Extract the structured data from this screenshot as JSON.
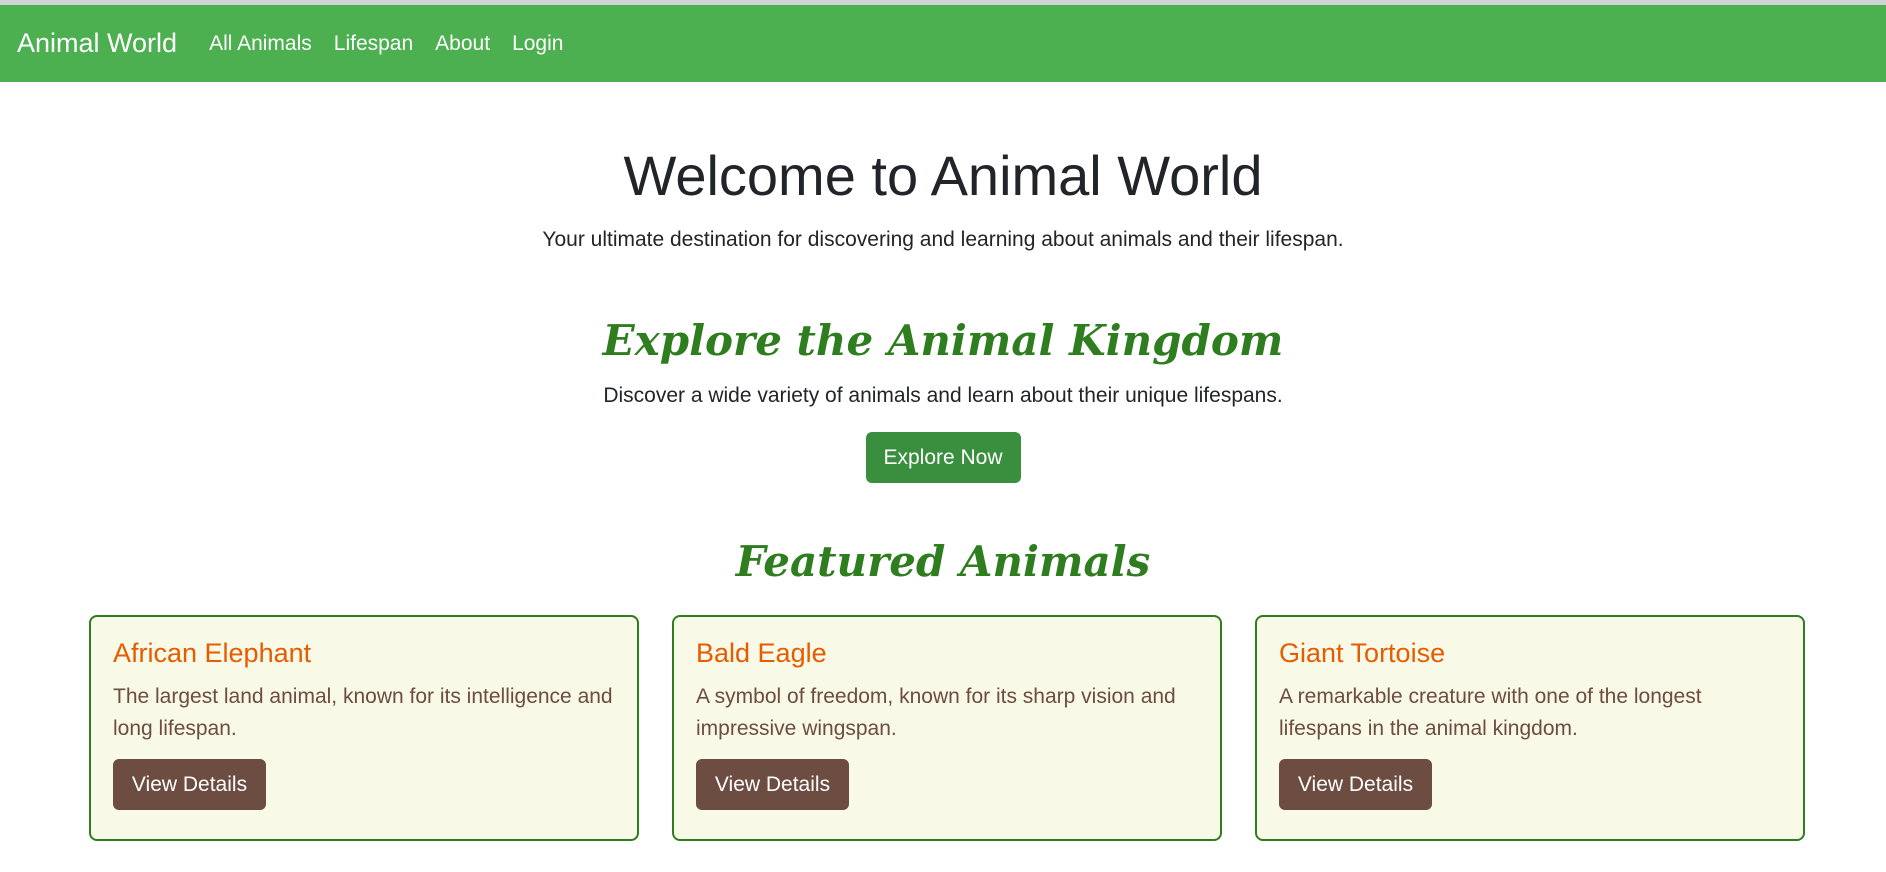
{
  "navbar": {
    "brand": "Animal World",
    "links": [
      "All Animals",
      "Lifespan",
      "About",
      "Login"
    ]
  },
  "hero": {
    "title": "Welcome to Animal World",
    "subtitle": "Your ultimate destination for discovering and learning about animals and their lifespan."
  },
  "explore": {
    "heading": "Explore the Animal Kingdom",
    "text": "Discover a wide variety of animals and learn about their unique lifespans.",
    "button_label": "Explore Now"
  },
  "featured": {
    "heading": "Featured Animals",
    "cards": [
      {
        "title": "African Elephant",
        "text": "The largest land animal, known for its intelligence and long lifespan.",
        "button_label": "View Details"
      },
      {
        "title": "Bald Eagle",
        "text": "A symbol of freedom, known for its sharp vision and impressive wingspan.",
        "button_label": "View Details"
      },
      {
        "title": "Giant Tortoise",
        "text": "A remarkable creature with one of the longest lifespans in the animal kingdom.",
        "button_label": "View Details"
      }
    ]
  },
  "colors": {
    "navbar_bg": "#4caf50",
    "heading_green": "#2e7d1f",
    "primary_button": "#3a8f3e",
    "card_bg": "#f8f9e6",
    "card_title": "#e65c00",
    "card_text": "#6d4c41",
    "card_button": "#6d4c41"
  }
}
